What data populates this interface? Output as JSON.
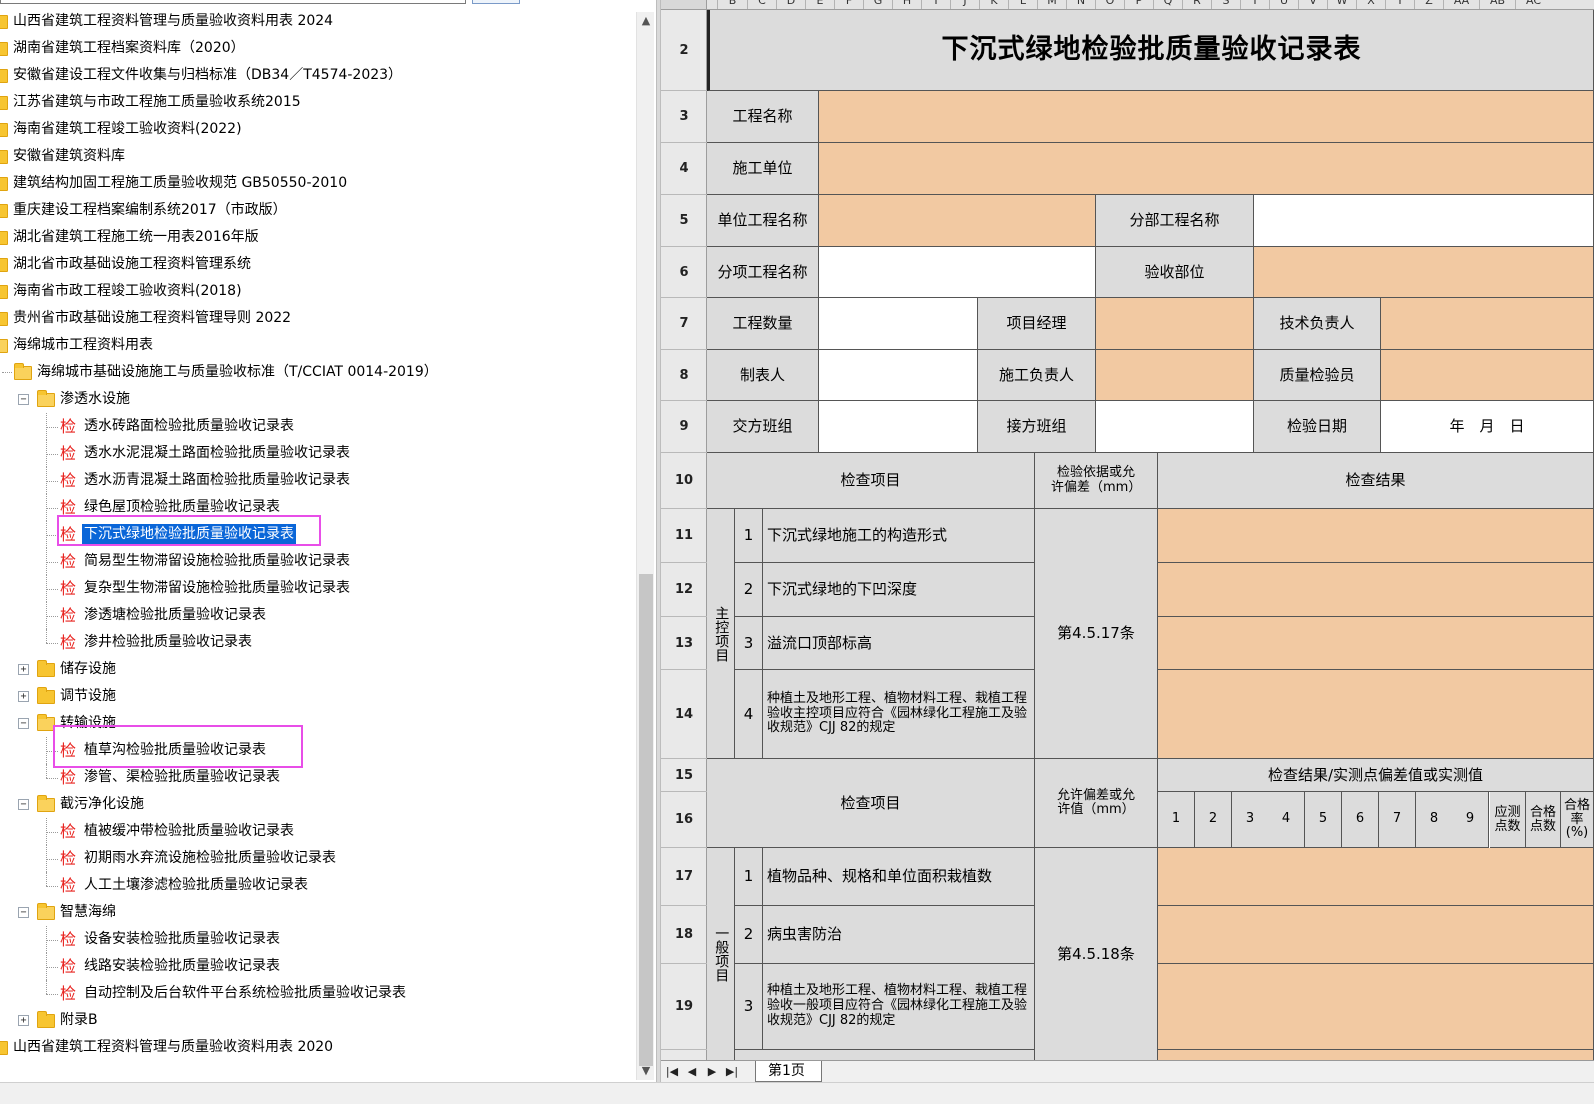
{
  "tree": {
    "top_nodes": [
      "山西省建筑工程资料管理与质量验收资料用表 2024",
      "湖南省建筑工程档案资料库（2020）",
      "安徽省建设工程文件收集与归档标准（DB34／T4574-2023）",
      "江苏省建筑与市政工程施工质量验收系统2015",
      "海南省建筑工程竣工验收资料(2022)",
      "安徽省建筑资料库",
      "建筑结构加固工程施工质量验收规范 GB50550-2010",
      "重庆建设工程档案编制系统2017（市政版）",
      "湖北省建筑工程施工统一用表2016年版",
      "湖北省市政基础设施工程资料管理系统",
      "海南省市政工程竣工验收资料(2018)",
      "贵州省市政基础设施工程资料管理导则 2022",
      "海绵城市工程资料用表"
    ],
    "standard_node": "海绵城市基础设施施工与质量验收标准（T/CCIAT 0014-2019）",
    "groups": [
      {
        "label": "渗透水设施",
        "expanded": true,
        "items": [
          "透水砖路面检验批质量验收记录表",
          "透水水泥混凝土路面检验批质量验收记录表",
          "透水沥青混凝土路面检验批质量验收记录表",
          "绿色屋顶检验批质量验收记录表",
          "下沉式绿地检验批质量验收记录表",
          "简易型生物滞留设施检验批质量验收记录表",
          "复杂型生物滞留设施检验批质量验收记录表",
          "渗透塘检验批质量验收记录表",
          "渗井检验批质量验收记录表"
        ]
      },
      {
        "label": "储存设施",
        "expanded": false,
        "items": []
      },
      {
        "label": "调节设施",
        "expanded": false,
        "items": []
      },
      {
        "label": "转输设施",
        "expanded": true,
        "items": [
          "植草沟检验批质量验收记录表",
          "渗管、渠检验批质量验收记录表"
        ]
      },
      {
        "label": "截污净化设施",
        "expanded": true,
        "items": [
          "植被缓冲带检验批质量验收记录表",
          "初期雨水弃流设施检验批质量验收记录表",
          "人工土壤渗滤检验批质量验收记录表"
        ]
      },
      {
        "label": "智慧海绵",
        "expanded": true,
        "items": [
          "设备安装检验批质量验收记录表",
          "线路安装检验批质量验收记录表",
          "自动控制及后台软件平台系统检验批质量验收记录表"
        ]
      },
      {
        "label": "附录B",
        "expanded": false,
        "items": []
      }
    ],
    "bottom_node": "山西省建筑工程资料管理与质量验收资料用表 2020",
    "item_icon_char": "检",
    "selected_item": "下沉式绿地检验批质量验收记录表",
    "highlighted_items": [
      "下沉式绿地检验批质量验收记录表",
      "植草沟检验批质量验收记录表"
    ]
  },
  "sheet": {
    "column_letters": [
      "B",
      "C",
      "D",
      "E",
      "F",
      "G",
      "H",
      "I",
      "J",
      "K",
      "L",
      "M",
      "N",
      "O",
      "P",
      "Q",
      "R",
      "S",
      "T",
      "U",
      "V",
      "W",
      "X",
      "Y",
      "Z",
      "AA",
      "AB",
      "AC"
    ],
    "row_numbers": [
      "2",
      "3",
      "4",
      "5",
      "6",
      "7",
      "8",
      "9",
      "10",
      "11",
      "12",
      "13",
      "14",
      "15",
      "16",
      "17",
      "18",
      "19"
    ],
    "title": "下沉式绿地检验批质量验收记录表",
    "labels": {
      "project_name": "工程名称",
      "construction_unit": "施工单位",
      "unit_project_name": "单位工程名称",
      "division_project_name": "分部工程名称",
      "subitem_project_name": "分项工程名称",
      "inspection_location": "验收部位",
      "quantity": "工程数量",
      "project_manager": "项目经理",
      "technical_lead": "技术负责人",
      "tabulator": "制表人",
      "construction_lead": "施工负责人",
      "quality_inspector": "质量检验员",
      "handover_team": "交方班组",
      "receiving_team": "接方班组",
      "inspection_date": "检验日期",
      "date_placeholder": "年　月　日",
      "check_item": "检查项目",
      "basis": "检验依据或允许偏差（mm）",
      "check_result": "检查结果",
      "main_control": "主控项目",
      "general": "一般项目",
      "result_measured": "检查结果/实测点偏差值或实测值",
      "allowable": "允许偏差或允许值（mm）",
      "should_measure": "应测点数",
      "qualified_points": "合格点数",
      "pass_rate": "合格率(%)"
    },
    "main_items": [
      {
        "no": "1",
        "text": "下沉式绿地施工的构造形式"
      },
      {
        "no": "2",
        "text": "下沉式绿地的下凹深度"
      },
      {
        "no": "3",
        "text": "溢流口顶部标高"
      },
      {
        "no": "4",
        "text": "种植土及地形工程、植物材料工程、栽植工程验收主控项目应符合《园林绿化工程施工及验收规范》CJJ 82的规定"
      }
    ],
    "main_basis": "第4.5.17条",
    "measure_points": [
      "1",
      "2",
      "3",
      "4",
      "5",
      "6",
      "7",
      "8",
      "9"
    ],
    "general_items": [
      {
        "no": "1",
        "text": "植物品种、规格和单位面积栽植数"
      },
      {
        "no": "2",
        "text": "病虫害防治"
      },
      {
        "no": "3",
        "text": "种植土及地形工程、植物材料工程、栽植工程验收一般项目应符合《园林绿化工程施工及验收规范》CJJ 82的规定"
      }
    ],
    "general_basis": "第4.5.18条",
    "tab_label": "第1页",
    "colors": {
      "input_orange": "#f2c9a2",
      "label_gray": "#dcdcdc",
      "highlight_magenta": "#e84ee8",
      "selection_blue": "#0a66d8",
      "item_icon_red": "#e8231f"
    }
  }
}
